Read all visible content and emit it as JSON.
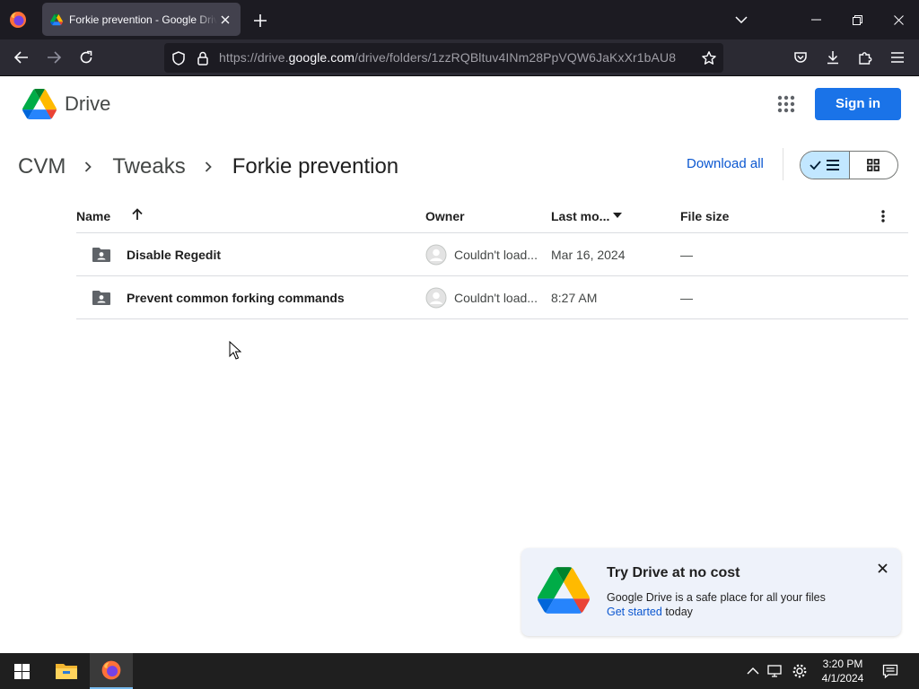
{
  "browser": {
    "tab_title": "Forkie prevention - Google Drive",
    "url_prefix": "https://drive.",
    "url_domain": "google.com",
    "url_path": "/drive/folders/1zzRQBltuv4INm28PpVQW6JaKxXr1bAU8"
  },
  "drive": {
    "app_name": "Drive",
    "signin_label": "Sign in"
  },
  "breadcrumb": [
    "CVM",
    "Tweaks",
    "Forkie prevention"
  ],
  "actions": {
    "download_all": "Download all"
  },
  "table": {
    "columns": {
      "name": "Name",
      "owner": "Owner",
      "modified": "Last mo...",
      "size": "File size"
    },
    "rows": [
      {
        "name": "Disable Regedit",
        "owner": "Couldn't load...",
        "modified": "Mar 16, 2024",
        "size": "—"
      },
      {
        "name": "Prevent common forking commands",
        "owner": "Couldn't load...",
        "modified": "8:27 AM",
        "size": "—"
      }
    ]
  },
  "promo": {
    "title": "Try Drive at no cost",
    "text": "Google Drive is a safe place for all your files",
    "link": "Get started",
    "link_suffix": " today"
  },
  "taskbar": {
    "time": "3:20 PM",
    "date": "4/1/2024"
  },
  "colors": {
    "accent": "#1a73e8",
    "link": "#0b57d0",
    "toggle_active": "#c2e7ff",
    "promo_bg": "#eef2fa",
    "browser_dark": "#1c1b22"
  },
  "icons": [
    "firefox-icon",
    "drive-icon",
    "close-icon",
    "plus-icon",
    "chevron-down-icon",
    "minimize-icon",
    "restore-icon",
    "back-icon",
    "forward-icon",
    "reload-icon",
    "shield-icon",
    "lock-icon",
    "star-icon",
    "pocket-icon",
    "download-icon",
    "extensions-icon",
    "menu-icon",
    "apps-grid-icon",
    "chevron-right-icon",
    "check-icon",
    "list-icon",
    "grid-icon",
    "arrow-up-icon",
    "sort-down-icon",
    "more-vert-icon",
    "shared-folder-icon",
    "avatar-icon",
    "windows-start-icon",
    "file-explorer-icon",
    "chevron-up-icon",
    "network-icon",
    "settings-icon",
    "notifications-icon"
  ]
}
